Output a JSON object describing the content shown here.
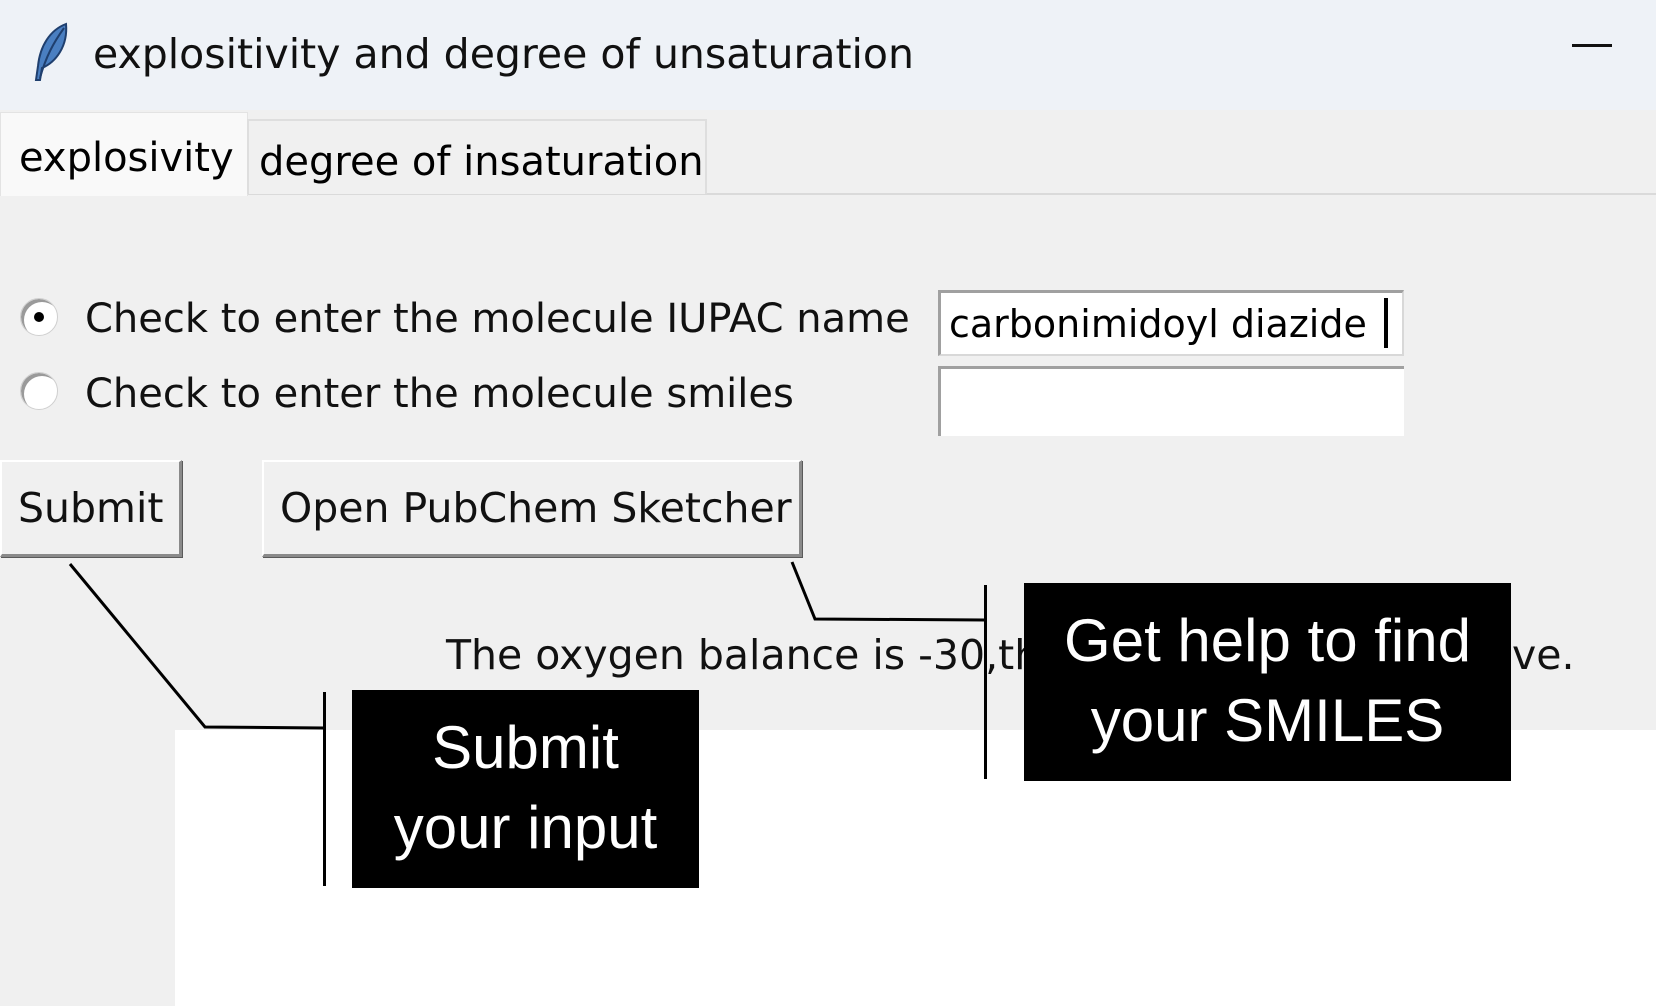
{
  "window": {
    "title": "explositivity and degree of unsaturation",
    "icon": "feather-icon"
  },
  "tabs": [
    {
      "label": "explosivity",
      "active": true
    },
    {
      "label": "degree of insaturation",
      "active": false
    }
  ],
  "form": {
    "radio_iupac_label": "Check to enter the molecule IUPAC name",
    "radio_smiles_label": "Check to enter the molecule smiles",
    "selected": "iupac",
    "iupac_value": "carbonimidoyl diazide",
    "smiles_value": ""
  },
  "buttons": {
    "submit": "Submit",
    "pubchem": "Open PubChem Sketcher"
  },
  "result": {
    "visible_start": "The oxygen balance is -30,the",
    "visible_end": "ve."
  },
  "callouts": {
    "submit_line1": "Submit",
    "submit_line2": "your input",
    "help_line1": "Get help to find",
    "help_line2": "your SMILES"
  },
  "colors": {
    "window_bg": "#f0f0f0",
    "titlebar_bg": "#eef2f7",
    "callout_bg": "#000000",
    "callout_text": "#ffffff",
    "feather": "#4a7fc1"
  }
}
